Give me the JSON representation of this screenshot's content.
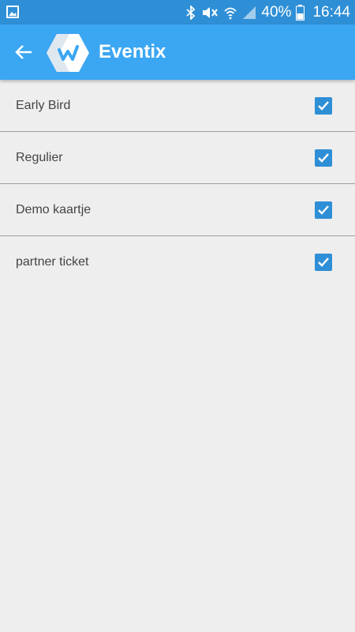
{
  "status_bar": {
    "battery": "40%",
    "time": "16:44",
    "icons": [
      "gallery-icon",
      "bluetooth-icon",
      "mute-icon",
      "wifi-icon",
      "signal-icon",
      "battery-icon"
    ]
  },
  "app_bar": {
    "title": "Eventix",
    "back_icon": "arrow-left-icon",
    "logo": "eventix-logo",
    "color": "#3ba6f2"
  },
  "tickets": [
    {
      "label": "Early Bird",
      "checked": true
    },
    {
      "label": "Regulier",
      "checked": true
    },
    {
      "label": "Demo kaartje",
      "checked": true
    },
    {
      "label": "partner ticket",
      "checked": true
    }
  ],
  "colors": {
    "status_bar": "#2f8fd6",
    "checkbox": "#2f8fd6",
    "background": "#eeeeee"
  }
}
